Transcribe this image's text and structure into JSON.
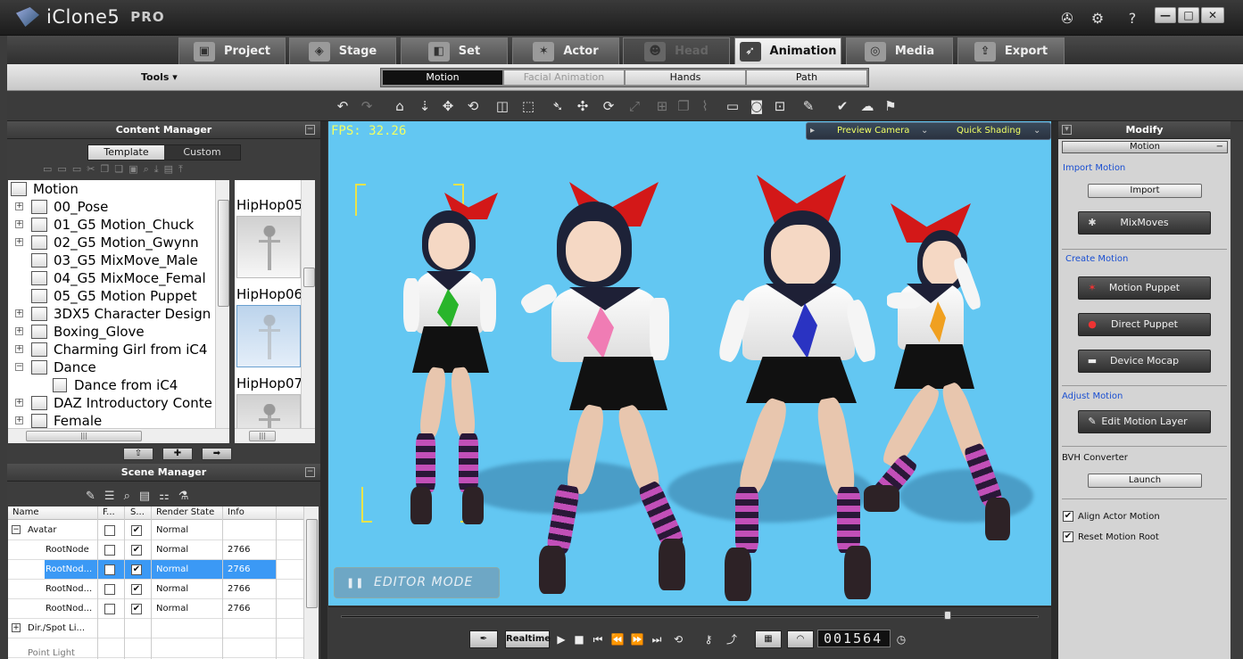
{
  "app": {
    "name": "iClone5",
    "edition": "PRO"
  },
  "titlebar_icons": [
    "joystick-icon",
    "gear-icon",
    "help-icon"
  ],
  "window_buttons": {
    "minimize": "—",
    "maximize": "□",
    "close": "✕"
  },
  "main_tabs": [
    {
      "label": "Project",
      "icon": "project-icon",
      "state": "normal"
    },
    {
      "label": "Stage",
      "icon": "stage-icon",
      "state": "normal"
    },
    {
      "label": "Set",
      "icon": "set-icon",
      "state": "normal"
    },
    {
      "label": "Actor",
      "icon": "actor-icon",
      "state": "normal"
    },
    {
      "label": "Head",
      "icon": "head-icon",
      "state": "disabled"
    },
    {
      "label": "Animation",
      "icon": "animation-icon",
      "state": "active"
    },
    {
      "label": "Media",
      "icon": "media-icon",
      "state": "normal"
    },
    {
      "label": "Export",
      "icon": "export-icon",
      "state": "normal"
    }
  ],
  "subbar": {
    "tools_menu": "Tools ▾",
    "tabs": [
      {
        "label": "Motion",
        "state": "active"
      },
      {
        "label": "Facial Animation",
        "state": "disabled"
      },
      {
        "label": "Hands",
        "state": "normal"
      },
      {
        "label": "Path",
        "state": "normal"
      }
    ]
  },
  "content_manager": {
    "title": "Content Manager",
    "tabs": [
      "Template",
      "Custom"
    ],
    "tree": [
      {
        "label": "Motion",
        "level": 0,
        "expander": ""
      },
      {
        "label": "00_Pose",
        "level": 1,
        "expander": "+"
      },
      {
        "label": "01_G5 Motion_Chuck",
        "level": 1,
        "expander": "+"
      },
      {
        "label": "02_G5 Motion_Gwynn",
        "level": 1,
        "expander": "+"
      },
      {
        "label": "03_G5 MixMove_Male",
        "level": 1,
        "expander": ""
      },
      {
        "label": "04_G5 MixMoce_Femal",
        "level": 1,
        "expander": ""
      },
      {
        "label": "05_G5 Motion Puppet",
        "level": 1,
        "expander": ""
      },
      {
        "label": "3DX5 Character Design",
        "level": 1,
        "expander": "+"
      },
      {
        "label": "Boxing_Glove",
        "level": 1,
        "expander": "+"
      },
      {
        "label": "Charming Girl from iC4",
        "level": 1,
        "expander": "+"
      },
      {
        "label": "Dance",
        "level": 1,
        "expander": "−"
      },
      {
        "label": "Dance from iC4",
        "level": 2,
        "expander": ""
      },
      {
        "label": "DAZ Introductory Conte",
        "level": 1,
        "expander": "+"
      },
      {
        "label": "Female",
        "level": 1,
        "expander": "+"
      }
    ],
    "thumbnails": [
      {
        "label": "HipHop05"
      },
      {
        "label": "HipHop06"
      },
      {
        "label": "HipHop07"
      }
    ],
    "nav_buttons": [
      "⇧",
      "✚",
      "➡"
    ]
  },
  "scene_manager": {
    "title": "Scene Manager",
    "columns": [
      "Name",
      "F...",
      "S...",
      "Render State",
      "Info"
    ],
    "rows": [
      {
        "name": "Avatar",
        "expander": "−",
        "freeze": "",
        "show": "✔",
        "render": "Normal",
        "info": "",
        "selected": false
      },
      {
        "name": "RootNode",
        "expander": "",
        "freeze": "",
        "show": "✔",
        "render": "Normal",
        "info": "2766",
        "selected": false
      },
      {
        "name": "RootNod...",
        "expander": "",
        "freeze": "",
        "show": "✔",
        "render": "Normal",
        "info": "2766",
        "selected": true
      },
      {
        "name": "RootNod...",
        "expander": "",
        "freeze": "",
        "show": "✔",
        "render": "Normal",
        "info": "2766",
        "selected": false
      },
      {
        "name": "RootNod...",
        "expander": "",
        "freeze": "",
        "show": "✔",
        "render": "Normal",
        "info": "2766",
        "selected": false
      },
      {
        "name": "Dir./Spot Li...",
        "expander": "+",
        "freeze": "",
        "show": "",
        "render": "",
        "info": "",
        "selected": false
      },
      {
        "name": "Point Light",
        "expander": "",
        "freeze": "",
        "show": "",
        "render": "",
        "info": "",
        "selected": false
      }
    ]
  },
  "viewport": {
    "fps": "FPS: 32.26",
    "preview_camera": "Preview Camera",
    "quick_shading": "Quick Shading",
    "mode": "EDITOR MODE",
    "background": "#63c7f2",
    "characters": [
      {
        "tie_color": "#29b52b"
      },
      {
        "tie_color": "#f07cb4"
      },
      {
        "tie_color": "#2a33c2"
      },
      {
        "tie_color": "#f0a020"
      }
    ]
  },
  "timeline": {
    "progress": 0.87,
    "realtime_label": "Realtime",
    "frame": "001564"
  },
  "modify": {
    "title": "Modify",
    "tab": "Motion",
    "import_motion": {
      "title": "Import Motion",
      "button": "Import"
    },
    "mixmoves": "MixMoves",
    "create_motion": {
      "title": "Create Motion",
      "buttons": [
        "Motion Puppet",
        "Direct Puppet",
        "Device Mocap"
      ]
    },
    "adjust_motion": {
      "title": "Adjust Motion",
      "button": "Edit Motion Layer"
    },
    "bvh": {
      "title": "BVH Converter",
      "button": "Launch"
    },
    "options": [
      {
        "label": "Align Actor Motion",
        "checked": true
      },
      {
        "label": "Reset Motion Root",
        "checked": true
      }
    ]
  }
}
